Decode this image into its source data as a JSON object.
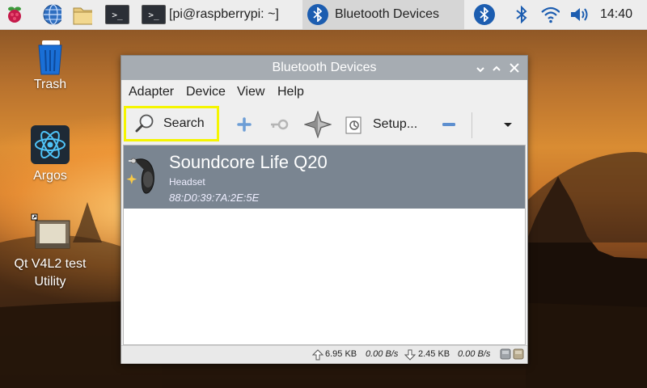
{
  "taskbar": {
    "tasks": [
      {
        "label": "[pi@raspberrypi: ~]"
      },
      {
        "label": "Bluetooth Devices"
      }
    ],
    "terminal_glyph": ">_",
    "clock": "14:40"
  },
  "desktop": {
    "icons": [
      {
        "label": "Trash"
      },
      {
        "label": "Argos"
      },
      {
        "label": "Qt V4L2 test\nUtility"
      }
    ]
  },
  "window": {
    "title": "Bluetooth Devices",
    "menu": [
      "Adapter",
      "Device",
      "View",
      "Help"
    ],
    "toolbar": {
      "search_label": "Search",
      "setup_label": "Setup..."
    },
    "devices": [
      {
        "name": "Soundcore Life Q20",
        "type": "Headset",
        "address": "88:D0:39:7A:2E:5E"
      }
    ],
    "status": {
      "upload_total": "6.95 KB",
      "upload_rate": "0.00 B/s",
      "download_total": "2.45 KB",
      "download_rate": "0.00 B/s"
    }
  },
  "colors": {
    "titlebar": "#a6acb2",
    "selected_row": "#7a8591",
    "highlight": "#f5f500",
    "bluetooth_blue": "#1c5db0"
  },
  "icons": [
    "raspberry-menu-icon",
    "web-browser-icon",
    "file-manager-icon",
    "terminal-icon",
    "bluetooth-icon",
    "wifi-icon",
    "volume-icon",
    "trash-icon",
    "argos-icon",
    "camera-icon",
    "search-icon",
    "add-icon",
    "pair-key-icon",
    "trust-star-icon",
    "setup-icon",
    "remove-icon",
    "dropdown-arrow-icon",
    "headset-icon"
  ]
}
